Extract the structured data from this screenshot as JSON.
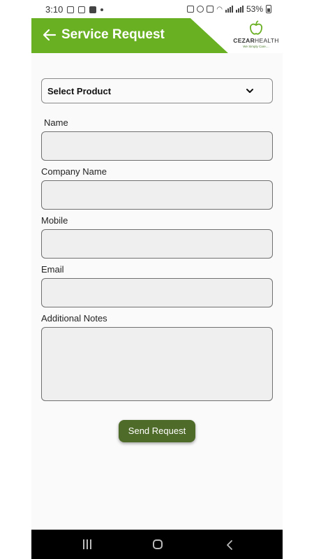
{
  "status_bar": {
    "time": "3:10",
    "battery": "53%"
  },
  "header": {
    "title": "Service Request",
    "back_icon": "arrow-left-icon",
    "logo": {
      "brand_bold": "CEZAR",
      "brand_light": "HEALTH",
      "tagline": "We Simply Care...."
    }
  },
  "form": {
    "product_select": {
      "value": "Select Product",
      "icon": "chevron-down-icon"
    },
    "fields": {
      "name": {
        "label": "Name"
      },
      "company": {
        "label": "Company Name"
      },
      "mobile": {
        "label": "Mobile"
      },
      "email": {
        "label": "Email"
      },
      "notes": {
        "label": "Additional Notes"
      }
    },
    "submit_label": "Send Request"
  },
  "colors": {
    "brand_green": "#6ab023",
    "button_green": "#4f6b2a",
    "field_bg": "#efefef"
  }
}
